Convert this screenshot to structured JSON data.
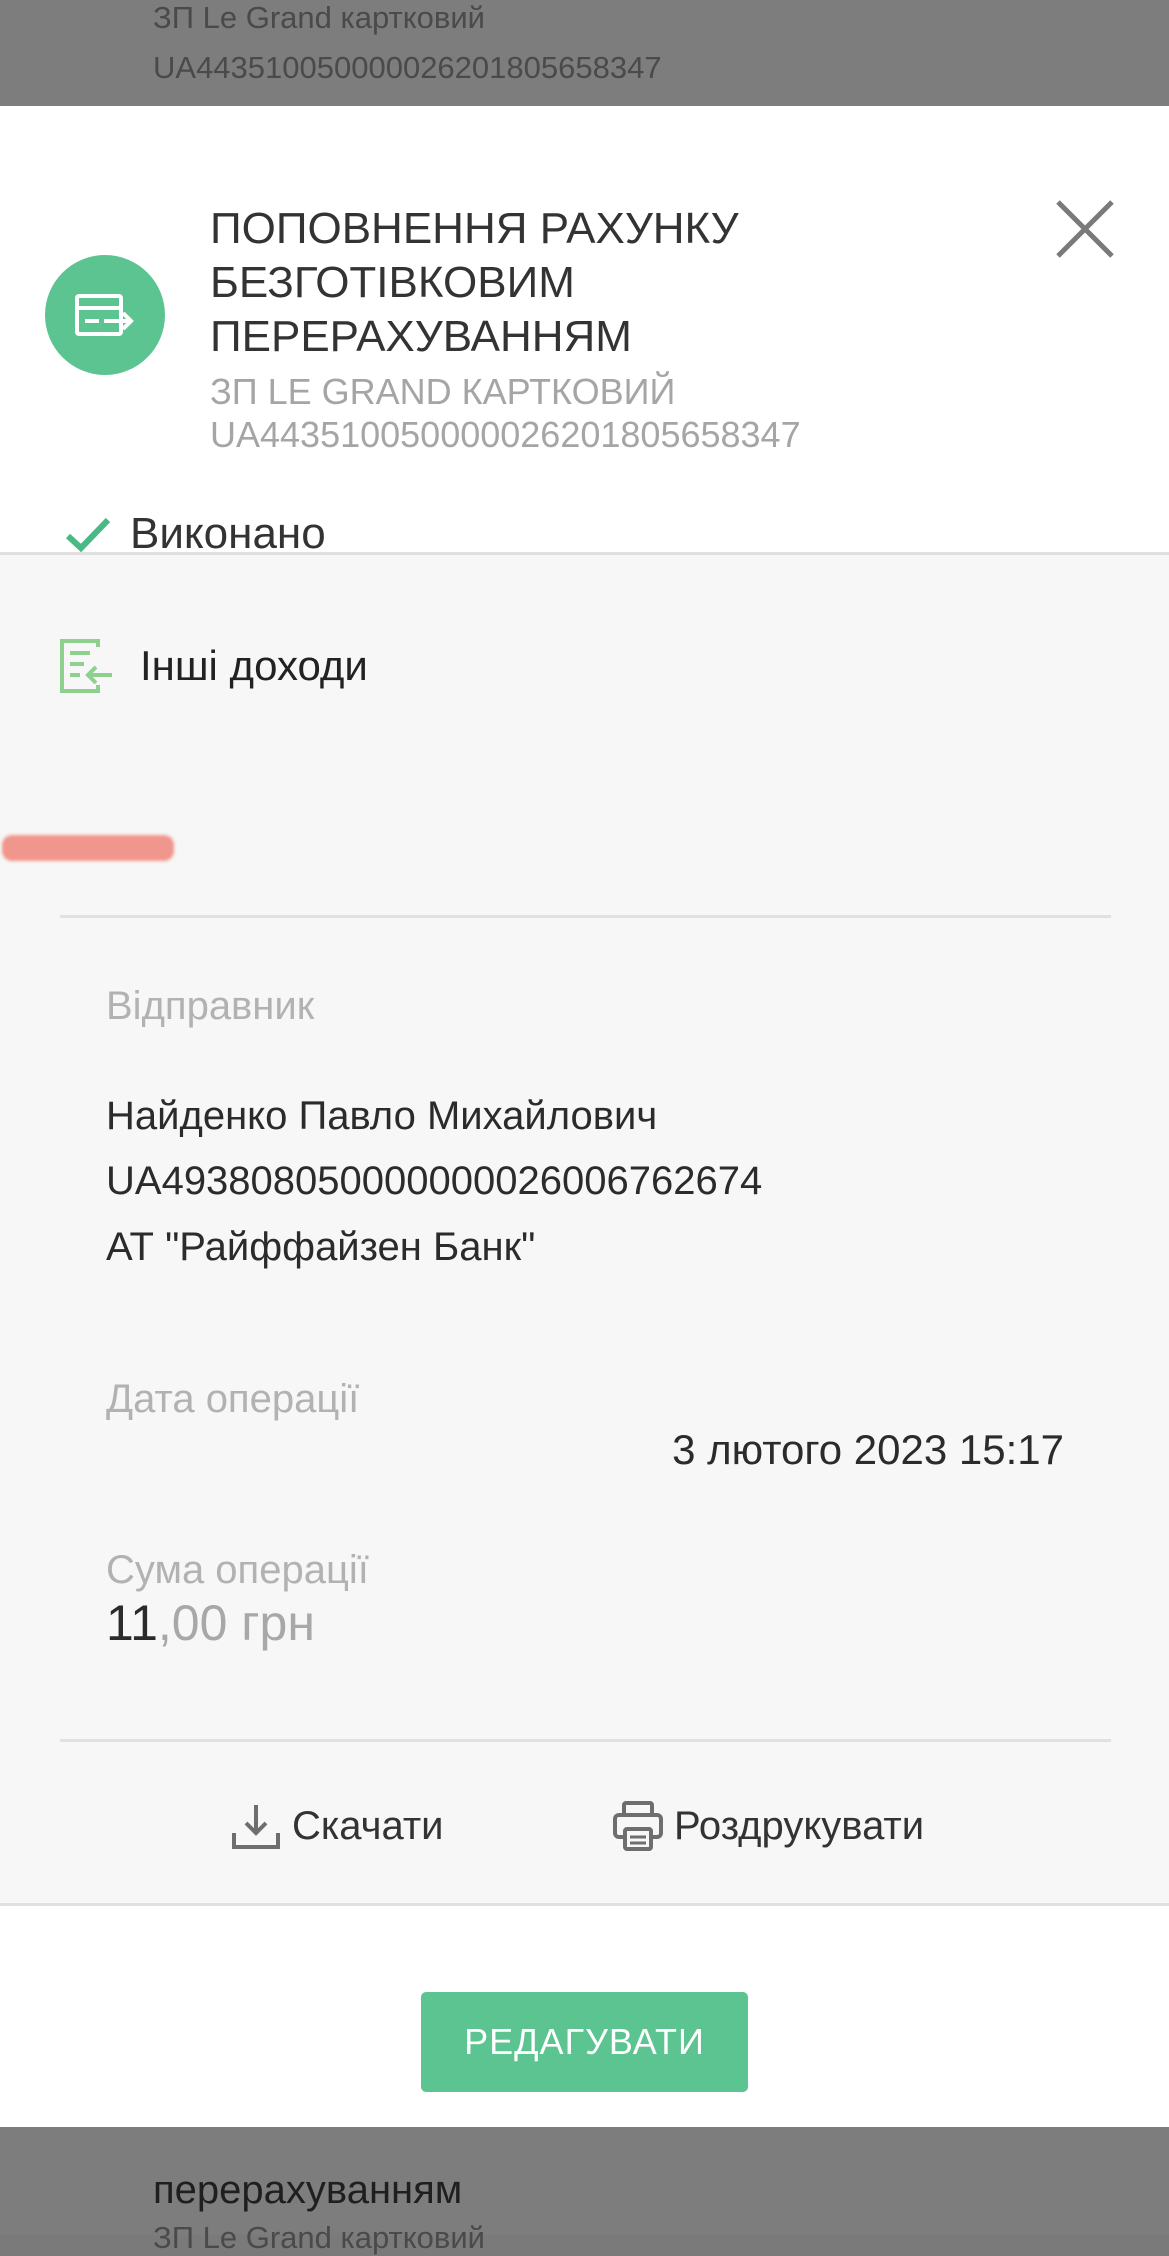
{
  "background": {
    "top_account_name": "ЗП Le Grand картковий",
    "top_account_iban": "UA443510050000026201805658347",
    "bottom_title_partial": "перерахуванням",
    "bottom_account_name": "ЗП Le Grand картковий"
  },
  "header": {
    "title_lines": [
      "ПОПОВНЕННЯ РАХУНКУ",
      "БЕЗГОТІВКОВИМ",
      "ПЕРЕРАХУВАННЯМ"
    ],
    "account_name": "ЗП LE GRAND КАРТКОВИЙ",
    "account_iban": "UA443510050000026201805658347",
    "icon": "transfer-icon",
    "close_icon": "close-icon"
  },
  "status": {
    "label": "Виконано",
    "icon": "check-icon"
  },
  "category": {
    "label": "Інші доходи",
    "icon": "income-category-icon"
  },
  "sender": {
    "label": "Відправник",
    "name": "Найденко Павло Михайлович",
    "iban": "UA493808050000000026006762674",
    "bank": "АТ \"Райффайзен Банк\""
  },
  "operation_date": {
    "label": "Дата операції",
    "value": "3 лютого 2023 15:17"
  },
  "operation_amount": {
    "label": "Сума операції",
    "integer": "11",
    "decimal": ",00 грн"
  },
  "actions": {
    "download": "Скачати",
    "print": "Роздрукувати"
  },
  "footer": {
    "edit_button": "РЕДАГУВАТИ"
  },
  "colors": {
    "accent": "#5cc491",
    "check": "#4ab986",
    "category_icon": "#8fd08f"
  }
}
